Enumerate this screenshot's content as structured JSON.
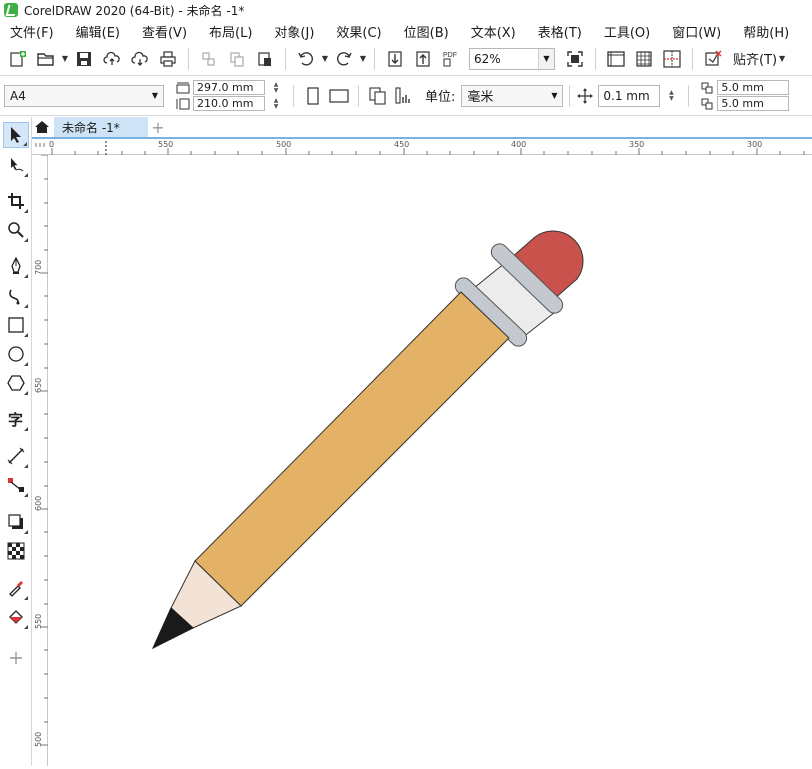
{
  "window": {
    "title": "CorelDRAW 2020 (64-Bit) - 未命名 -1*"
  },
  "menu": [
    "文件(F)",
    "编辑(E)",
    "查看(V)",
    "布局(L)",
    "对象(J)",
    "效果(C)",
    "位图(B)",
    "文本(X)",
    "表格(T)",
    "工具(O)",
    "窗口(W)",
    "帮助(H)"
  ],
  "toolbar": {
    "zoom_value": "62%",
    "snap_label": "贴齐(T)"
  },
  "property_bar": {
    "page_size": "A4",
    "width": "297.0 mm",
    "height": "210.0 mm",
    "unit_label": "单位:",
    "unit_value": "毫米",
    "nudge": "0.1 mm",
    "dup_x": "5.0 mm",
    "dup_y": "5.0 mm"
  },
  "tabs": {
    "document_name": "未命名 -1*"
  },
  "ruler_h": [
    "0",
    "550",
    "500",
    "450",
    "400",
    "350",
    "300"
  ],
  "ruler_v": [
    "700",
    "650",
    "600",
    "550",
    "500"
  ],
  "colors": {
    "pencil_body": "#e3b266",
    "pencil_wood": "#f3e2d6",
    "pencil_lead": "#1a1a1a",
    "ferrule_band": "#c4c9cf",
    "ferrule_body": "#ececec",
    "eraser": "#c9524d",
    "accent": "#7bb1e0"
  },
  "icons": [
    "home-icon",
    "pick-tool-icon",
    "shape-tool-icon",
    "crop-tool-icon",
    "zoom-tool-icon",
    "freehand-tool-icon",
    "artistic-media-icon",
    "rectangle-tool-icon",
    "ellipse-tool-icon",
    "polygon-tool-icon",
    "text-tool-icon",
    "dimension-tool-icon",
    "connector-tool-icon",
    "drop-shadow-icon",
    "transparency-icon",
    "eyedropper-icon",
    "fill-icon",
    "add-tool-icon"
  ]
}
